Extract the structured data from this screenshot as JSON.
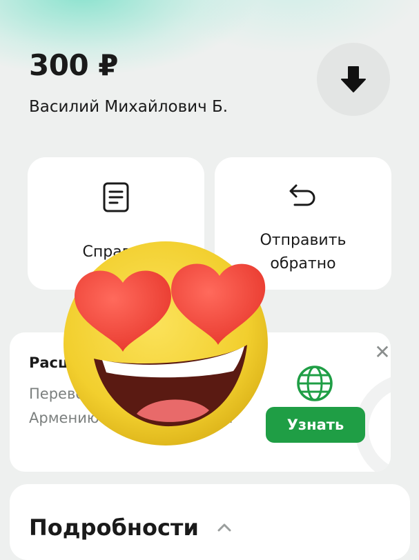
{
  "header": {
    "amount": "300 ₽",
    "recipient": "Василий Михайлович Б."
  },
  "header_actions": {
    "download_icon": "download-arrow-icon"
  },
  "actions": [
    {
      "label": "Справка",
      "icon": "document-icon"
    },
    {
      "label": "Отправить обратно",
      "icon": "return-arrow-icon"
    }
  ],
  "promo": {
    "title": "Расширьте",
    "text": "Переводите в Китай, Армению и ещё 20+ стран",
    "button_label": "Узнать",
    "close_icon": "close-icon",
    "globe_icon": "globe-icon",
    "accent_color": "#1f9e45"
  },
  "details": {
    "title": "Подробности",
    "chevron_icon": "chevron-up-icon"
  },
  "sticker": {
    "icon": "heart-eyes-emoji"
  }
}
